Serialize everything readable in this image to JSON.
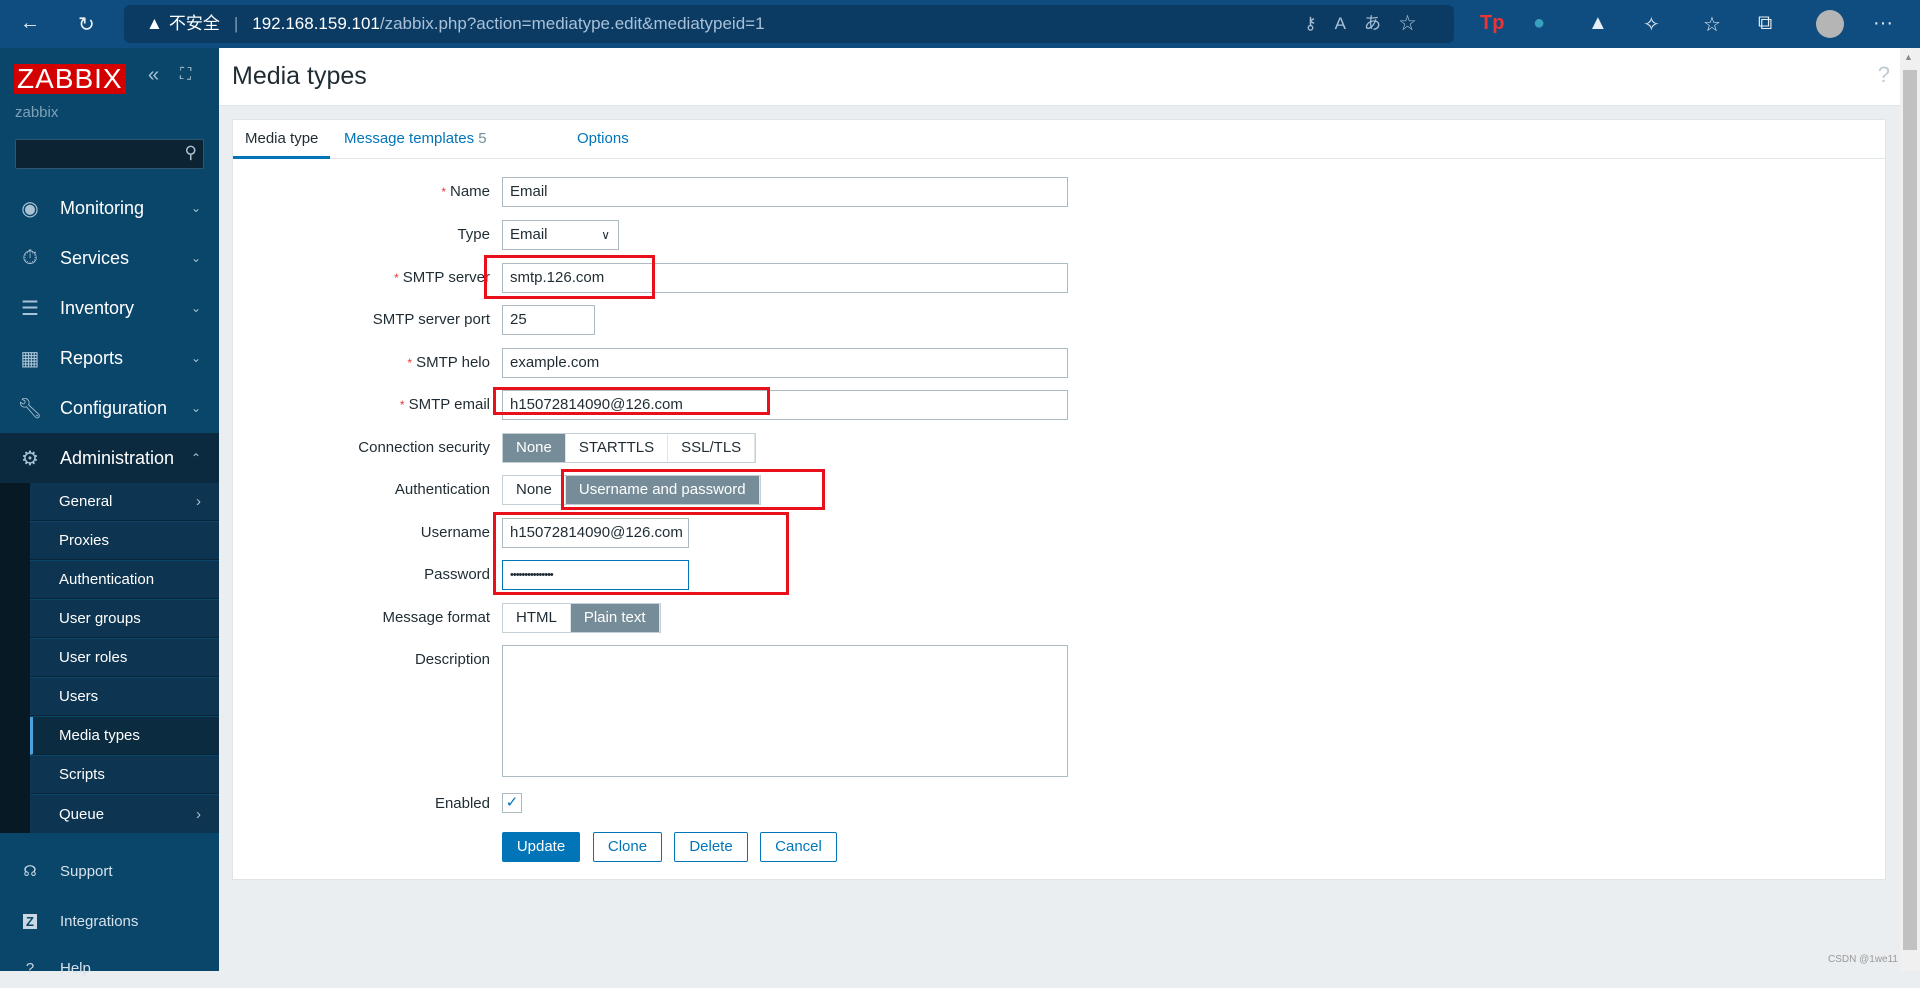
{
  "browser": {
    "security_label": "不安全",
    "url_host": "192.168.159.101",
    "url_path": "/zabbix.php?action=mediatype.edit&mediatypeid=1",
    "icons": [
      "back-icon",
      "reload-icon",
      "key-icon",
      "read-aloud-icon",
      "translate-icon",
      "add-favorite-icon",
      "extension-tp-icon",
      "extension-bowl-icon",
      "extension-mountain-icon",
      "extensions-icon",
      "favorites-icon",
      "collections-icon",
      "profile-icon",
      "more-icon"
    ]
  },
  "sidebar": {
    "logo": "ZABBIX",
    "server_name": "zabbix",
    "menu": [
      {
        "label": "Monitoring",
        "icon": "eye-icon"
      },
      {
        "label": "Services",
        "icon": "stopwatch-icon"
      },
      {
        "label": "Inventory",
        "icon": "list-icon"
      },
      {
        "label": "Reports",
        "icon": "chart-icon"
      },
      {
        "label": "Configuration",
        "icon": "wrench-icon"
      },
      {
        "label": "Administration",
        "icon": "gear-icon"
      }
    ],
    "submenu": [
      {
        "label": "General",
        "arrow": true
      },
      {
        "label": "Proxies"
      },
      {
        "label": "Authentication"
      },
      {
        "label": "User groups"
      },
      {
        "label": "User roles"
      },
      {
        "label": "Users"
      },
      {
        "label": "Media types",
        "active": true
      },
      {
        "label": "Scripts"
      },
      {
        "label": "Queue",
        "arrow": true
      }
    ],
    "footer": [
      {
        "label": "Support",
        "icon": "headset-icon"
      },
      {
        "label": "Integrations",
        "icon": "zabbix-z-icon"
      },
      {
        "label": "Help",
        "icon": "help-icon"
      }
    ]
  },
  "header": {
    "title": "Media types",
    "help": "?"
  },
  "tabs": [
    {
      "label": "Media type",
      "active": true
    },
    {
      "label": "Message templates",
      "count": "5"
    },
    {
      "label": "Options"
    }
  ],
  "form": {
    "name": {
      "label": "Name",
      "value": "Email"
    },
    "type": {
      "label": "Type",
      "value": "Email"
    },
    "smtp_server": {
      "label": "SMTP server",
      "value": "smtp.126.com"
    },
    "smtp_port": {
      "label": "SMTP server port",
      "value": "25"
    },
    "smtp_helo": {
      "label": "SMTP helo",
      "value": "example.com"
    },
    "smtp_email": {
      "label": "SMTP email",
      "value": "h15072814090@126.com"
    },
    "connection_security": {
      "label": "Connection security",
      "options": [
        "None",
        "STARTTLS",
        "SSL/TLS"
      ],
      "selected": "None"
    },
    "authentication": {
      "label": "Authentication",
      "options": [
        "None",
        "Username and password"
      ],
      "selected": "Username and password"
    },
    "username": {
      "label": "Username",
      "value": "h15072814090@126.com"
    },
    "password": {
      "label": "Password",
      "value": "•••••••••••••••"
    },
    "message_format": {
      "label": "Message format",
      "options": [
        "HTML",
        "Plain text"
      ],
      "selected": "Plain text"
    },
    "description": {
      "label": "Description",
      "value": ""
    },
    "enabled": {
      "label": "Enabled",
      "checked": true
    },
    "buttons": {
      "update": "Update",
      "clone": "Clone",
      "delete": "Delete",
      "cancel": "Cancel"
    }
  },
  "annotation_color": "#e8101a",
  "watermark": "CSDN @1we11"
}
